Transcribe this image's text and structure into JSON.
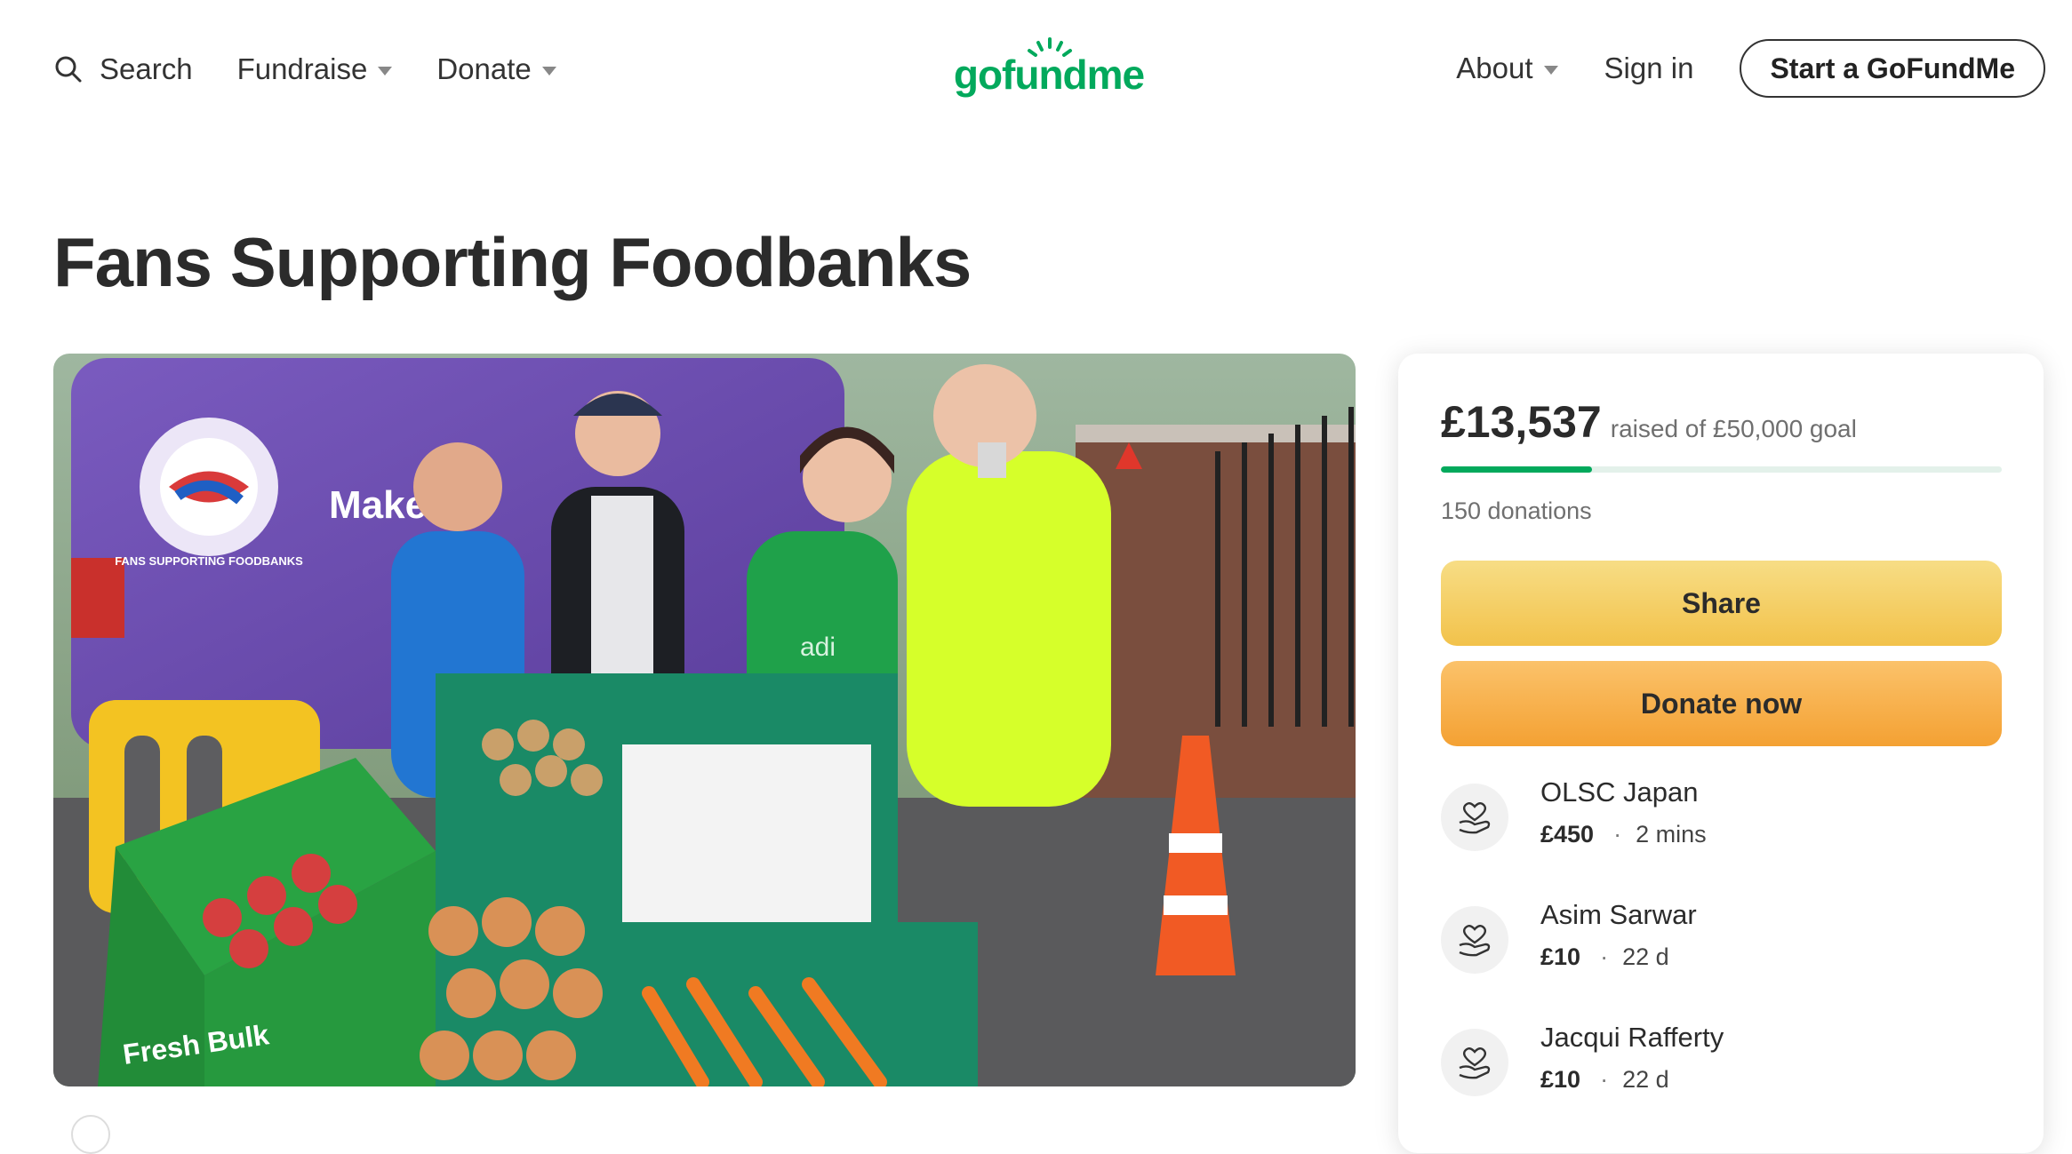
{
  "header": {
    "search_label": "Search",
    "fundraise_label": "Fundraise",
    "donate_label": "Donate",
    "logo_text": "gofundme",
    "about_label": "About",
    "signin_label": "Sign in",
    "start_label": "Start a GoFundMe"
  },
  "page": {
    "title": "Fans Supporting Foodbanks"
  },
  "hero": {
    "van_text": "Make y",
    "van_logo_text": "FANS SUPPORTING FOODBANKS",
    "crate_text": "Fresh Bulk",
    "hoodie_text": "adi"
  },
  "fundraiser": {
    "raised": "£13,537",
    "goal_text": "raised of £50,000 goal",
    "progress_fraction": 0.27,
    "donations_count": "150 donations",
    "share_label": "Share",
    "donate_now_label": "Donate now"
  },
  "donors": [
    {
      "name": "OLSC Japan",
      "amount": "£450",
      "time": "2 mins"
    },
    {
      "name": "Asim Sarwar",
      "amount": "£10",
      "time": "22 d"
    },
    {
      "name": "Jacqui Rafferty",
      "amount": "£10",
      "time": "22 d"
    }
  ],
  "colors": {
    "brand_green": "#02a95c",
    "share_yellow": "#f2c24b",
    "donate_orange": "#f4a133"
  }
}
